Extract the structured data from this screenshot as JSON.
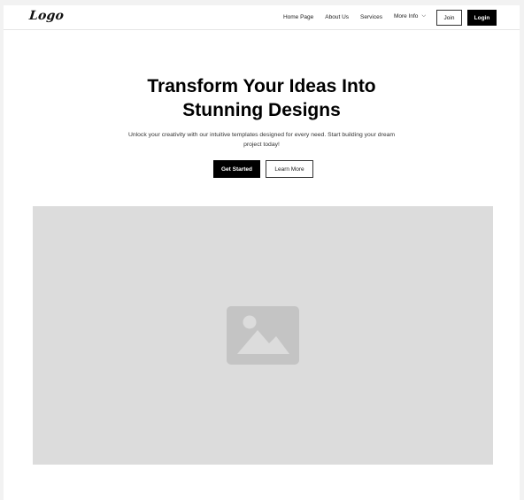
{
  "header": {
    "logo": "Logo",
    "nav": [
      {
        "label": "Home Page"
      },
      {
        "label": "About Us"
      },
      {
        "label": "Services"
      },
      {
        "label": "More Info",
        "icon": "chevron-down-icon"
      }
    ],
    "join_label": "Join",
    "login_label": "Login"
  },
  "hero": {
    "title_line1": "Transform Your Ideas Into",
    "title_line2": "Stunning Designs",
    "subtitle": "Unlock your creativity with our intuitive templates designed for every need. Start building your dream project today!",
    "primary_cta": "Get Started",
    "secondary_cta": "Learn More"
  },
  "media": {
    "icon": "image-placeholder-icon"
  },
  "colors": {
    "background": "#ffffff",
    "placeholder": "#dcdcdc",
    "placeholder_icon": "#c4c4c4",
    "primary": "#000000"
  }
}
